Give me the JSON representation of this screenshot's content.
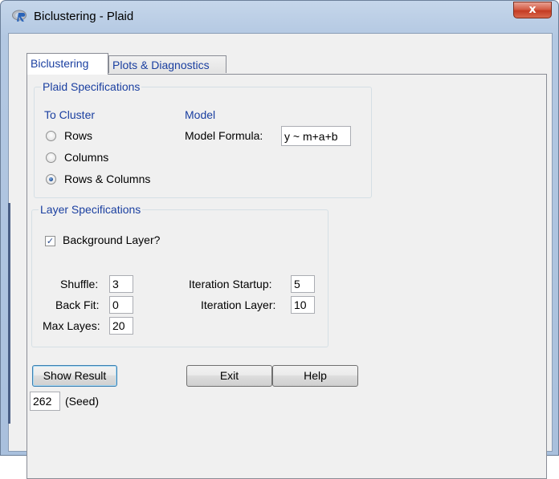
{
  "window": {
    "title": "Biclustering - Plaid",
    "close_label": "x"
  },
  "tabs": [
    {
      "label": "Biclustering",
      "active": true
    },
    {
      "label": "Plots & Diagnostics",
      "active": false
    }
  ],
  "plaid_specs": {
    "legend": "Plaid Specifications",
    "to_cluster_heading": "To Cluster",
    "options": [
      {
        "label": "Rows",
        "selected": false
      },
      {
        "label": "Columns",
        "selected": false
      },
      {
        "label": "Rows & Columns",
        "selected": true
      }
    ],
    "model_heading": "Model",
    "model_formula_label": "Model Formula:",
    "model_formula_value": "y ~ m+a+b"
  },
  "layer_specs": {
    "legend": "Layer Specifications",
    "background_layer_label": "Background Layer?",
    "background_layer_checked": true,
    "shuffle_label": "Shuffle:",
    "shuffle_value": "3",
    "back_fit_label": "Back Fit:",
    "back_fit_value": "0",
    "max_layes_label": "Max Layes:",
    "max_layes_value": "20",
    "iteration_startup_label": "Iteration Startup:",
    "iteration_startup_value": "5",
    "iteration_layer_label": "Iteration Layer:",
    "iteration_layer_value": "10"
  },
  "actions": {
    "show_result_label": "Show Result",
    "exit_label": "Exit",
    "help_label": "Help",
    "seed_value": "262",
    "seed_label": "(Seed)"
  },
  "colors": {
    "accent_text": "#1a3fa0",
    "close_button": "#c43c24"
  }
}
